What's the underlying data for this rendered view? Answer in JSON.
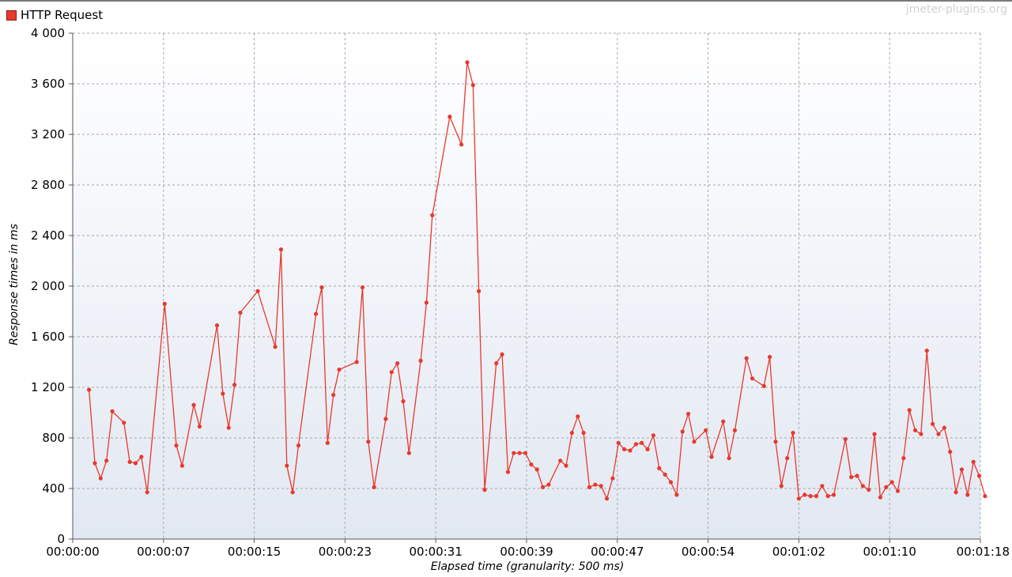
{
  "legend": {
    "label": "HTTP Request",
    "color": "#e8392d"
  },
  "watermark": "jmeter-plugins.org",
  "chart_data": {
    "type": "line",
    "title": "",
    "xlabel": "Elapsed time (granularity: 500 ms)",
    "ylabel": "Response times in ms",
    "ylim": [
      0,
      4000
    ],
    "yticks": [
      0,
      400,
      800,
      1200,
      1600,
      2000,
      2400,
      2800,
      3200,
      3600,
      4000
    ],
    "ytick_labels": [
      "0",
      "400",
      "800",
      "1 200",
      "1 600",
      "2 000",
      "2 400",
      "2 800",
      "3 200",
      "3 600",
      "4 000"
    ],
    "xlim": [
      0,
      78
    ],
    "xticks": [
      0,
      7.8,
      15.6,
      23.4,
      31.2,
      39,
      46.8,
      54.6,
      62.4,
      70.2,
      78
    ],
    "xtick_labels": [
      "00:00:00",
      "00:00:07",
      "00:00:15",
      "00:00:23",
      "00:00:31",
      "00:00:39",
      "00:00:47",
      "00:00:54",
      "00:01:02",
      "00:01:10",
      "00:01:18"
    ],
    "grid": true,
    "series": [
      {
        "name": "HTTP Request",
        "color": "#e8392d",
        "points": [
          [
            1.4,
            1180
          ],
          [
            1.9,
            600
          ],
          [
            2.4,
            480
          ],
          [
            2.9,
            620
          ],
          [
            3.4,
            1010
          ],
          [
            4.4,
            920
          ],
          [
            4.9,
            610
          ],
          [
            5.4,
            600
          ],
          [
            5.9,
            650
          ],
          [
            6.4,
            370
          ],
          [
            7.9,
            1860
          ],
          [
            8.9,
            740
          ],
          [
            9.4,
            580
          ],
          [
            10.4,
            1060
          ],
          [
            10.9,
            890
          ],
          [
            12.4,
            1690
          ],
          [
            12.9,
            1150
          ],
          [
            13.4,
            880
          ],
          [
            13.9,
            1220
          ],
          [
            14.4,
            1790
          ],
          [
            15.9,
            1960
          ],
          [
            17.4,
            1520
          ],
          [
            17.9,
            2290
          ],
          [
            18.4,
            580
          ],
          [
            18.9,
            370
          ],
          [
            19.4,
            740
          ],
          [
            20.9,
            1780
          ],
          [
            21.4,
            1990
          ],
          [
            21.9,
            760
          ],
          [
            22.4,
            1140
          ],
          [
            22.9,
            1340
          ],
          [
            24.4,
            1400
          ],
          [
            24.9,
            1990
          ],
          [
            25.4,
            770
          ],
          [
            25.9,
            410
          ],
          [
            26.9,
            950
          ],
          [
            27.4,
            1320
          ],
          [
            27.9,
            1390
          ],
          [
            28.4,
            1090
          ],
          [
            28.9,
            680
          ],
          [
            29.9,
            1410
          ],
          [
            30.4,
            1870
          ],
          [
            30.9,
            2560
          ],
          [
            32.4,
            3340
          ],
          [
            33.4,
            3120
          ],
          [
            33.9,
            3770
          ],
          [
            34.4,
            3590
          ],
          [
            34.9,
            1960
          ],
          [
            35.4,
            390
          ],
          [
            36.4,
            1390
          ],
          [
            36.9,
            1460
          ],
          [
            37.4,
            530
          ],
          [
            37.9,
            680
          ],
          [
            38.4,
            680
          ],
          [
            38.9,
            680
          ],
          [
            39.4,
            590
          ],
          [
            39.9,
            550
          ],
          [
            40.4,
            410
          ],
          [
            40.9,
            430
          ],
          [
            41.9,
            620
          ],
          [
            42.4,
            580
          ],
          [
            42.9,
            840
          ],
          [
            43.4,
            970
          ],
          [
            43.9,
            840
          ],
          [
            44.4,
            410
          ],
          [
            44.9,
            430
          ],
          [
            45.4,
            420
          ],
          [
            45.9,
            320
          ],
          [
            46.4,
            480
          ],
          [
            46.9,
            760
          ],
          [
            47.4,
            710
          ],
          [
            47.9,
            700
          ],
          [
            48.4,
            750
          ],
          [
            48.9,
            760
          ],
          [
            49.4,
            710
          ],
          [
            49.9,
            820
          ],
          [
            50.4,
            560
          ],
          [
            50.9,
            510
          ],
          [
            51.4,
            450
          ],
          [
            51.9,
            350
          ],
          [
            52.4,
            850
          ],
          [
            52.9,
            990
          ],
          [
            53.4,
            770
          ],
          [
            54.4,
            860
          ],
          [
            54.9,
            650
          ],
          [
            55.9,
            930
          ],
          [
            56.4,
            640
          ],
          [
            56.9,
            860
          ],
          [
            57.9,
            1430
          ],
          [
            58.4,
            1270
          ],
          [
            59.4,
            1210
          ],
          [
            59.9,
            1440
          ],
          [
            60.4,
            770
          ],
          [
            60.9,
            420
          ],
          [
            61.4,
            640
          ],
          [
            61.9,
            840
          ],
          [
            62.4,
            320
          ],
          [
            62.9,
            350
          ],
          [
            63.4,
            340
          ],
          [
            63.9,
            340
          ],
          [
            64.4,
            420
          ],
          [
            64.9,
            340
          ],
          [
            65.4,
            350
          ],
          [
            66.4,
            790
          ],
          [
            66.9,
            490
          ],
          [
            67.4,
            500
          ],
          [
            67.9,
            420
          ],
          [
            68.4,
            390
          ],
          [
            68.9,
            830
          ],
          [
            69.4,
            330
          ],
          [
            69.9,
            410
          ],
          [
            70.4,
            450
          ],
          [
            70.9,
            380
          ],
          [
            71.4,
            640
          ],
          [
            71.9,
            1020
          ],
          [
            72.4,
            860
          ],
          [
            72.9,
            830
          ],
          [
            73.4,
            1490
          ],
          [
            73.9,
            910
          ],
          [
            74.4,
            830
          ],
          [
            74.9,
            880
          ],
          [
            75.4,
            690
          ],
          [
            75.9,
            370
          ],
          [
            76.4,
            550
          ],
          [
            76.9,
            350
          ],
          [
            77.4,
            610
          ],
          [
            77.9,
            500
          ],
          [
            78.4,
            340
          ]
        ]
      }
    ]
  }
}
